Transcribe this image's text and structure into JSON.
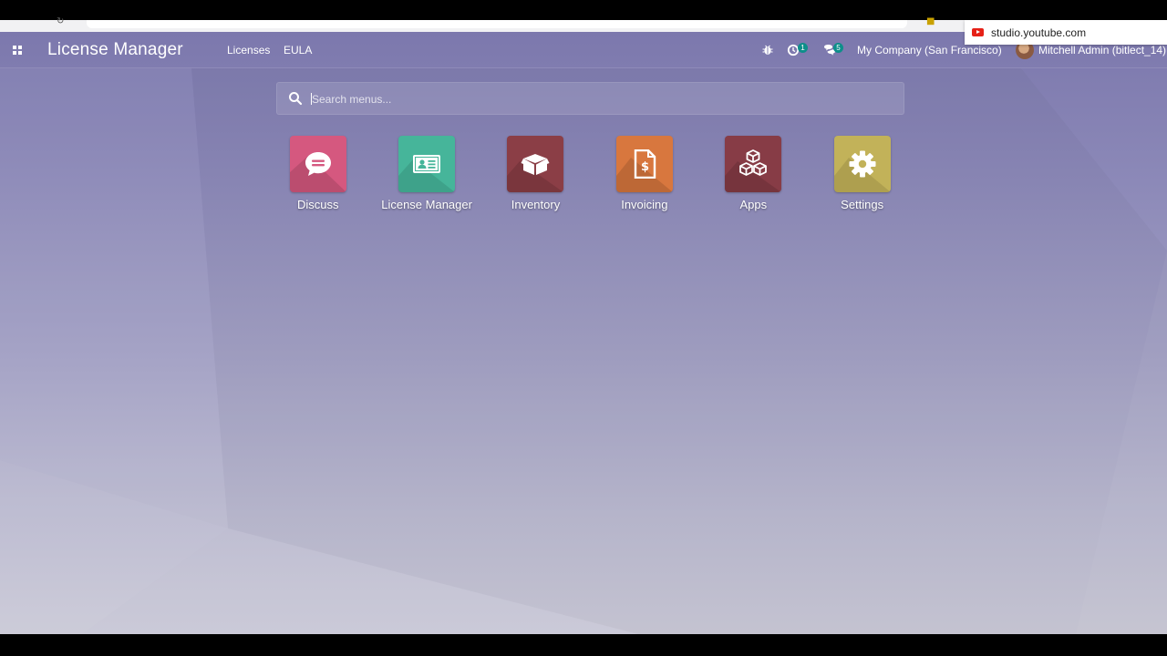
{
  "browser": {
    "popup_url": "studio.youtube.com"
  },
  "navbar": {
    "app_title": "License Manager",
    "menu": [
      {
        "label": "Licenses"
      },
      {
        "label": "EULA"
      }
    ],
    "activity_count": "1",
    "message_count": "5",
    "company": "My Company (San Francisco)",
    "user": "Mitchell Admin (bitlect_14)"
  },
  "search": {
    "placeholder": "Search menus..."
  },
  "apps": [
    {
      "label": "Discuss",
      "icon": "chat-bubble-icon",
      "color": "#d5587f"
    },
    {
      "label": "License Manager",
      "icon": "id-card-icon",
      "color": "#46b59a"
    },
    {
      "label": "Inventory",
      "icon": "box-icon",
      "color": "#8b3e46"
    },
    {
      "label": "Invoicing",
      "icon": "invoice-dollar-icon",
      "color": "#d8773e"
    },
    {
      "label": "Apps",
      "icon": "cubes-icon",
      "color": "#873c46"
    },
    {
      "label": "Settings",
      "icon": "gear-icon",
      "color": "#c2b259"
    }
  ],
  "colors": {
    "background_top": "#7c78ad",
    "background_bottom": "#c9c8d6",
    "badge": "#0d8f8a"
  }
}
